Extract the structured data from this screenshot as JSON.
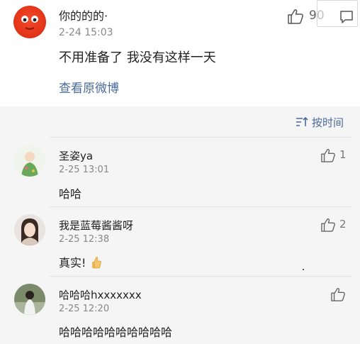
{
  "post": {
    "author": "你的的的·",
    "time": "2-24 15:03",
    "text": "不用准备了 我没有这样一天",
    "view_original": "查看原微博",
    "like_count": "90"
  },
  "sort": {
    "label": "按时间"
  },
  "comments": [
    {
      "name": "圣姿ya",
      "time": "2-25 13:01",
      "text": "哈哈",
      "likes": "1"
    },
    {
      "name": "我是蓝莓酱酱呀",
      "time": "2-25 12:38",
      "text": "真实!",
      "likes": "2"
    },
    {
      "name": "哈哈哈hxxxxxxx",
      "time": "2-25 12:20",
      "text": "哈哈哈哈哈哈哈哈哈哈",
      "likes": ""
    }
  ],
  "icons": {
    "like": "thumbs-up-icon",
    "comment": "comment-icon",
    "sort": "sort-icon",
    "emoji": "thumbs-up-emoji"
  },
  "colors": {
    "link": "#4a6a9a",
    "muted": "#888888",
    "background": "#f5f5f5"
  }
}
